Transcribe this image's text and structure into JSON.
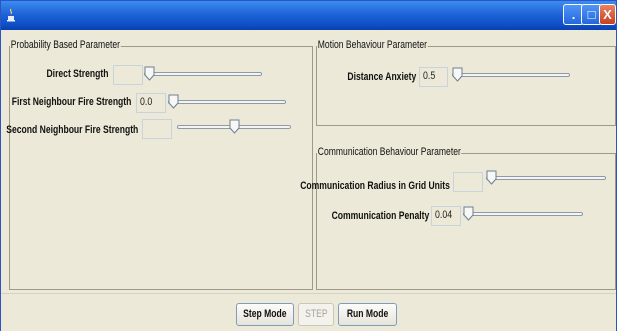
{
  "window": {
    "title": "",
    "controls": {
      "minimize": ".",
      "maximize": "□",
      "close": "X"
    },
    "accent": "#1e64d8"
  },
  "probability_panel": {
    "title": "Probability Based Parameter",
    "rows": [
      {
        "label": "Direct Strength",
        "value": "",
        "slider_fraction": 0.0
      },
      {
        "label": "First Neighbour Fire Strength",
        "value": "0.0",
        "slider_fraction": 0.0
      },
      {
        "label": "Second Neighbour Fire Strength",
        "value": "",
        "slider_fraction": 0.5
      }
    ]
  },
  "motion_panel": {
    "title": "Motion Behaviour Parameter",
    "rows": [
      {
        "label": "Distance Anxiety",
        "value": "0.5",
        "slider_fraction": 0.0
      }
    ]
  },
  "communication_panel": {
    "title": "Communication Behaviour Parameter",
    "rows": [
      {
        "label": "Communication Radius in Grid Units",
        "value": "",
        "slider_fraction": 0.0
      },
      {
        "label": "Communication Penalty",
        "value": "0.04",
        "slider_fraction": 0.0
      }
    ]
  },
  "buttons": {
    "step_mode": "Step Mode",
    "step": "STEP",
    "run_mode": "Run Mode"
  }
}
